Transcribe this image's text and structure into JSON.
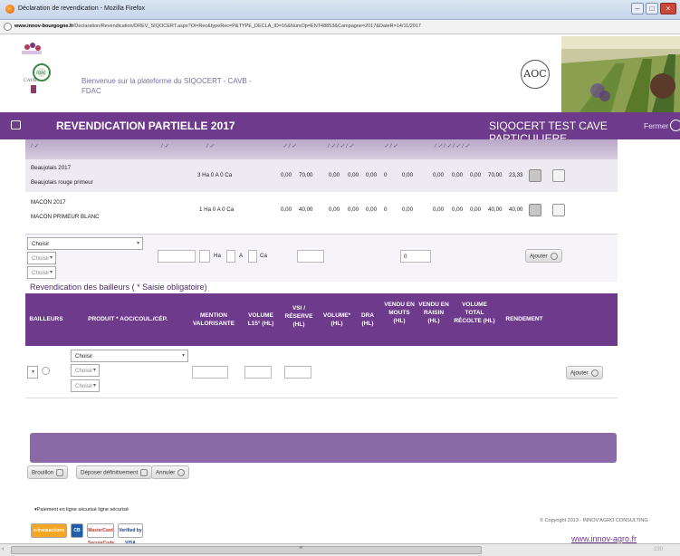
{
  "window": {
    "title": "Déclaration de revendication - Mozilla Firefox",
    "url_host": "www.innov-bourgogne.fr",
    "url_path": "/Declaration/Revendication/DREV_SIQOCERT.aspx?Oi=Rec&typeRec=P&TYPE_DECLA_ID=16&NumOp=ENT48853&Campagne=2017&DateR=14/11/2017"
  },
  "header": {
    "welcome": "Bienvenue sur la plateforme du SIQOCERT - CAVB - FDAC",
    "aoc_logo": "AOC"
  },
  "navbar": {
    "title": "REVENDICATION PARTIELLE 2017",
    "organization": "SIQOCERT TEST CAVE PARTICULIERE",
    "close_label": "Fermer"
  },
  "rows": [
    {
      "appellation": "Beaujolais 2017",
      "product": "Beaujolais rouge primeur",
      "surface": "3 Ha 0 A 0 Ca",
      "v1": "0,00",
      "v2": "70,00",
      "v3": "0,00",
      "v4": "0,00",
      "v5": "0,00",
      "v6": "0",
      "v7": "0,00",
      "v8": "0,00",
      "v9": "0,00",
      "v10": "0,00",
      "v11": "70,00",
      "v12": "23,33"
    },
    {
      "appellation": "MACON 2017",
      "product": "MACON PRIMEUR BLANC",
      "surface": "1 Ha 0 A 0 Ca",
      "v1": "0,00",
      "v2": "40,00",
      "v3": "0,00",
      "v4": "0,00",
      "v5": "0,00",
      "v6": "0",
      "v7": "0,00",
      "v8": "0,00",
      "v9": "0,00",
      "v10": "0,00",
      "v11": "40,00",
      "v12": "40,00"
    }
  ],
  "add_form": {
    "select_main": "Choisir",
    "select_sub1": "Choisir",
    "select_sub2": "Choisir",
    "unit_ha": "Ha",
    "unit_a": "A",
    "unit_ca": "Ca",
    "zero_value": "0",
    "add_button": "Ajouter"
  },
  "bailleurs": {
    "section_title": "Revendication des bailleurs ( * Saisie obligatoire)",
    "columns": [
      "BAILLEURS",
      "PRODUIT * AOC/COUL./CÉP.",
      "MENTION VALORISANTE",
      "VOLUME L15° (HL)",
      "VSI / RÉSERVE (HL)",
      "VOLUME* (HL)",
      "DRA (HL)",
      "VENDU EN MOUTS (HL)",
      "VENDU EN RAISIN (HL)",
      "VOLUME TOTAL RÉCOLTE (HL)",
      "RENDEMENT"
    ],
    "row": {
      "product_select": "Choisir",
      "sub1": "Choisir",
      "sub2": "Choisir",
      "add_button": "Ajouter"
    }
  },
  "actions": {
    "draft": "Brouillon",
    "submit": "Déposer définitivement",
    "cancel": "Annuler"
  },
  "footer": {
    "payment": "▾Paiement en ligne sécurisé ligne sécurisé",
    "cards": [
      "e-transactions",
      "CB",
      "MasterCard SecureCode",
      "Verified by VISA"
    ],
    "copyright": "© Copyright 2013 - INNOV'AGRO CONSULTING",
    "website": "www.innov-agro.fr"
  },
  "statusbar": {
    "size_text": "230"
  },
  "colors": {
    "brand_purple": "#6d3a8c",
    "bar_purple": "#8a6aa6"
  }
}
